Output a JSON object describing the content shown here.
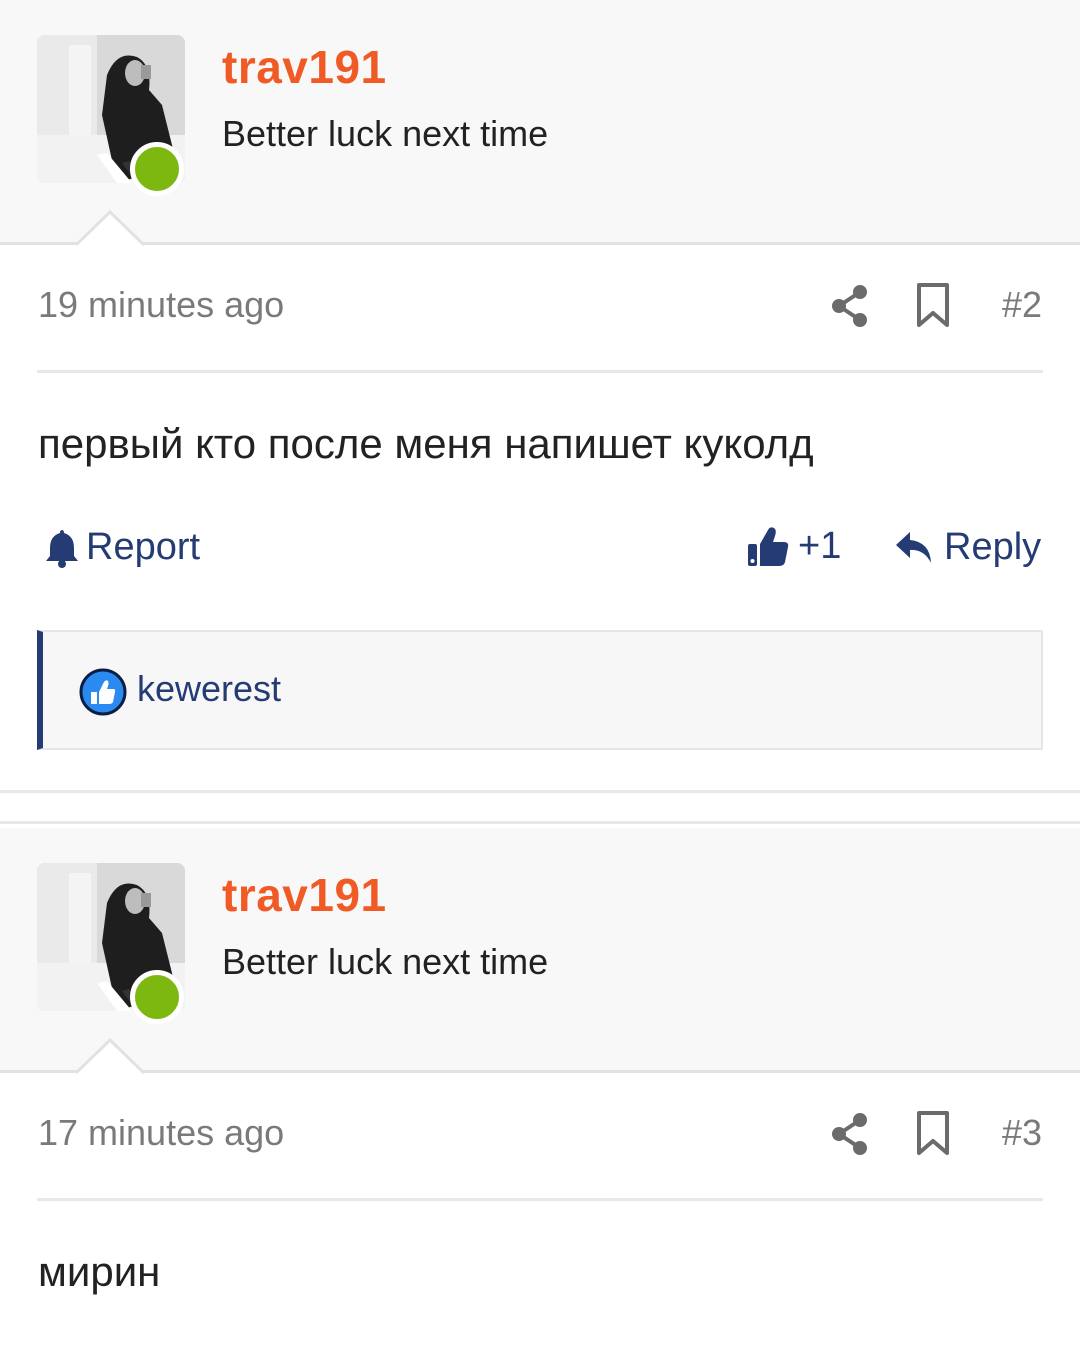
{
  "posts": [
    {
      "username": "trav191",
      "user_title": "Better luck next time",
      "timestamp": "19 minutes ago",
      "number": "#2",
      "message": "первый кто после меня напишет куколд",
      "actions": {
        "report": "Report",
        "like_count": "+1",
        "reply": "Reply"
      },
      "reactions": [
        {
          "user": "kewerest",
          "icon": "thumbs-up-icon"
        }
      ]
    },
    {
      "username": "trav191",
      "user_title": "Better luck next time",
      "timestamp": "17 minutes ago",
      "number": "#3",
      "message": "мирин"
    }
  ],
  "colors": {
    "username": "#f05a24",
    "link": "#243b73",
    "online": "#7cb80f",
    "muted": "#7a7a7a"
  }
}
